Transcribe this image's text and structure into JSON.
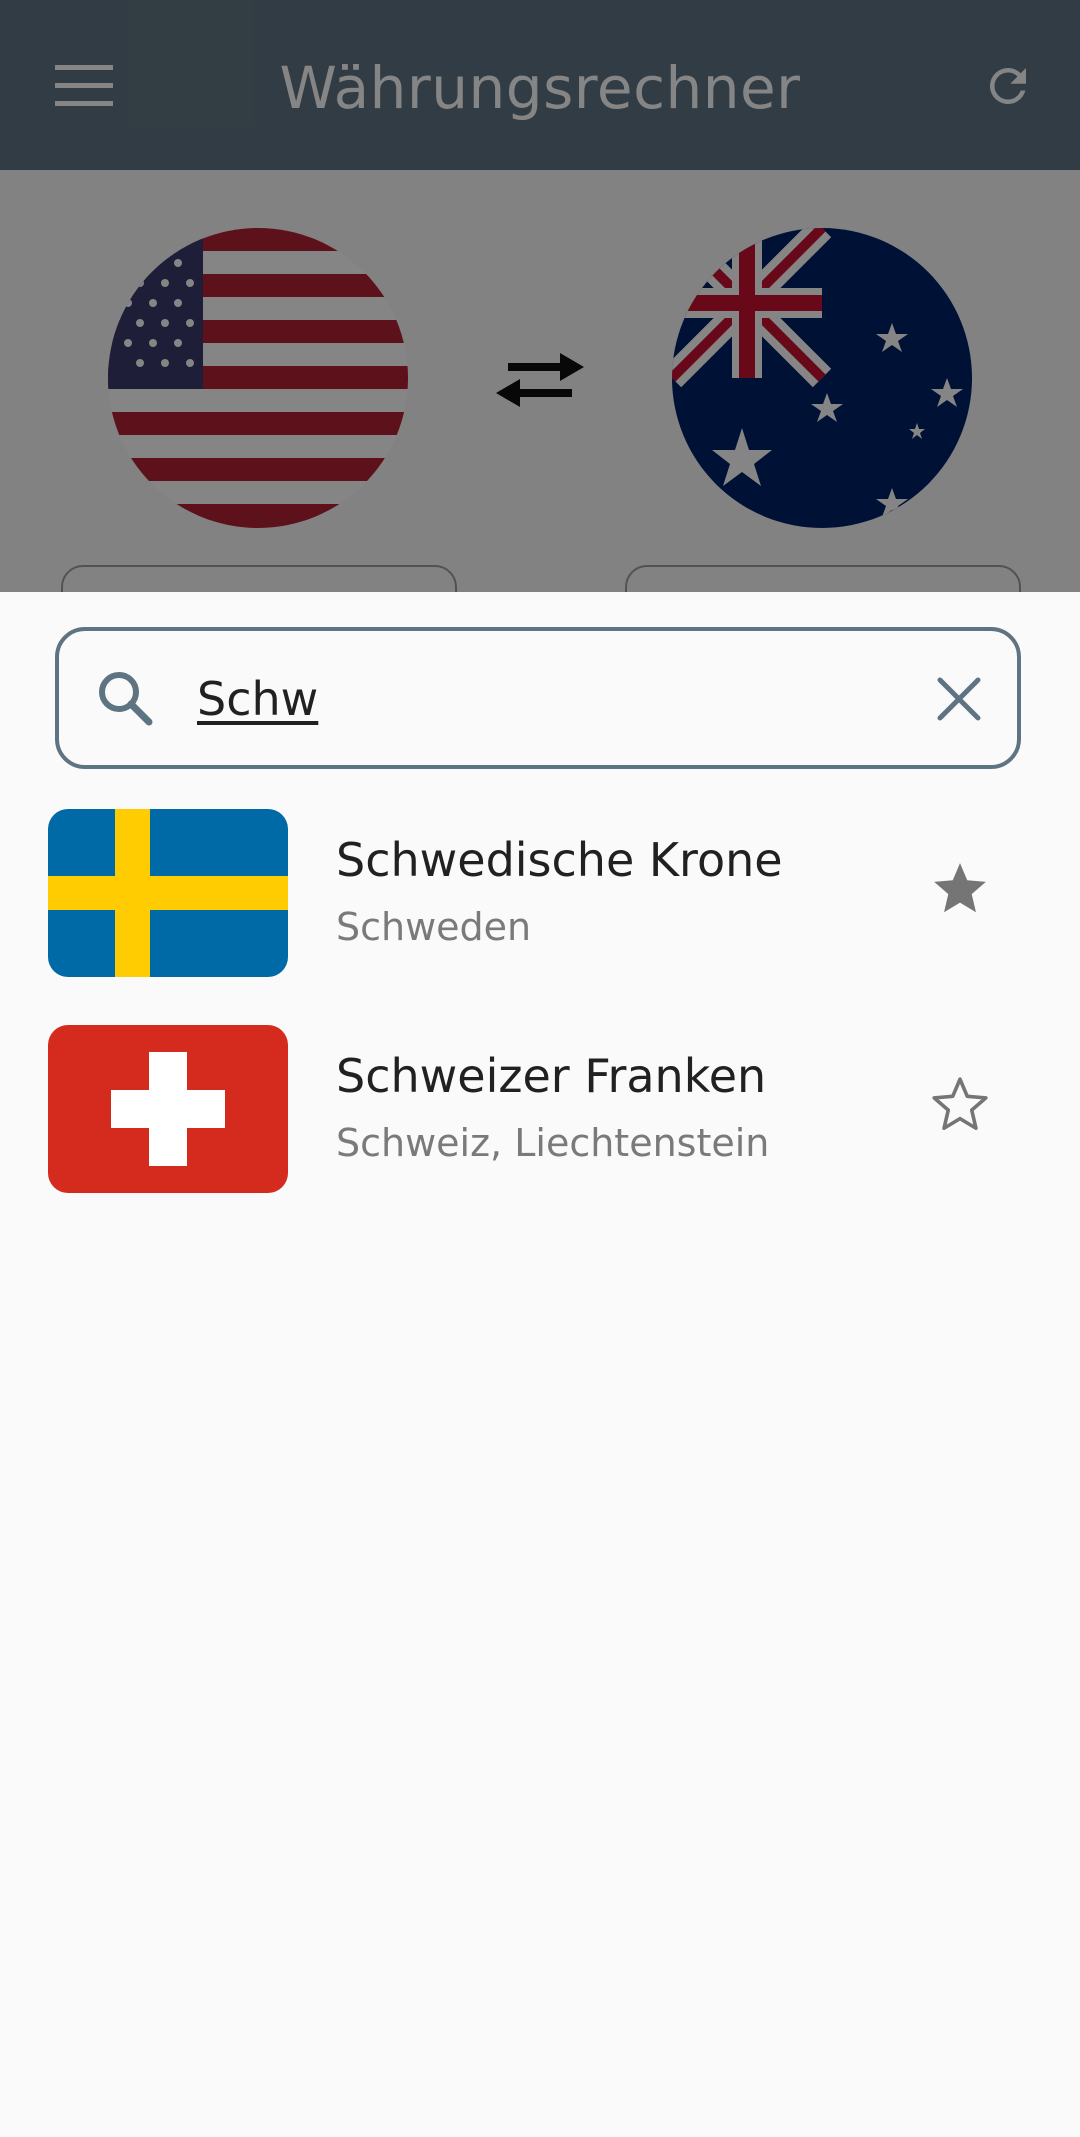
{
  "app_bar": {
    "title": "Währungsrechner",
    "menu_icon": "menu-icon",
    "refresh_icon": "refresh-icon",
    "background": "#5f7482"
  },
  "converter": {
    "from_flag": "us-flag",
    "to_flag": "au-flag",
    "swap_icon": "swap-arrows-icon"
  },
  "search": {
    "icon": "search-icon",
    "value": "Schw",
    "clear_icon": "close-icon",
    "border_color": "#5f7482"
  },
  "results": [
    {
      "flag": "se-flag",
      "currency": "Schwedische Krone",
      "countries": "Schweden",
      "favorite": true
    },
    {
      "flag": "ch-flag",
      "currency": "Schweizer Franken",
      "countries": "Schweiz, Liechtenstein",
      "favorite": false
    }
  ]
}
